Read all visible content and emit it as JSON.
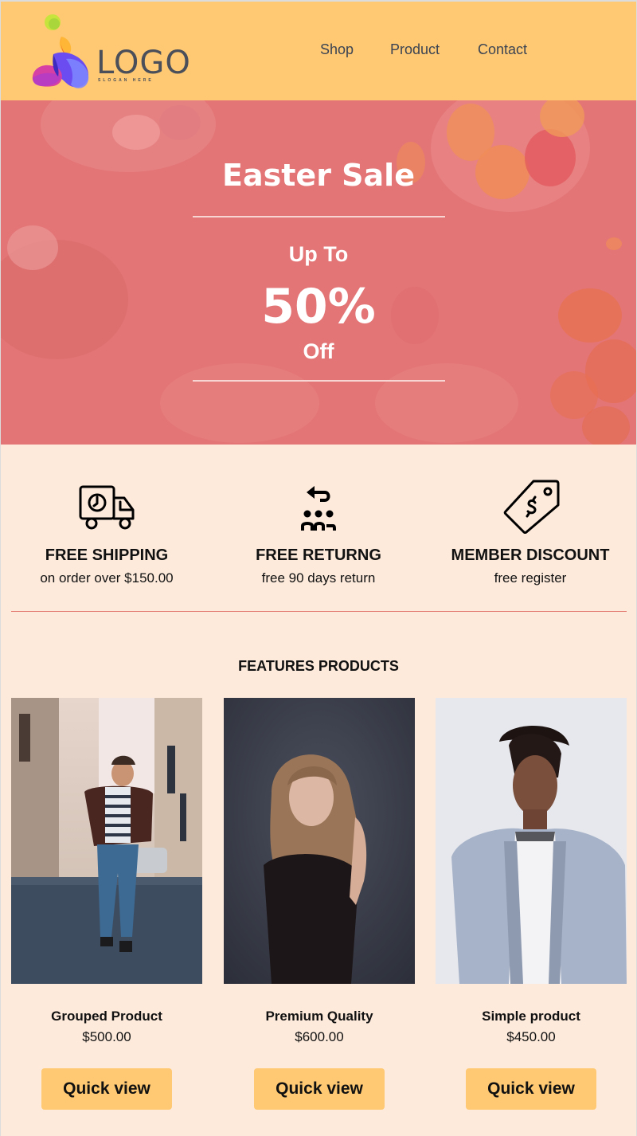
{
  "header": {
    "logo_text": "LOGO",
    "logo_slogan": "SLOGAN HERE",
    "nav": [
      {
        "label": "Shop"
      },
      {
        "label": "Product"
      },
      {
        "label": "Contact"
      }
    ]
  },
  "hero": {
    "title": "Easter Sale",
    "up_to": "Up To",
    "percent": "50%",
    "off": "Off"
  },
  "features": [
    {
      "icon": "delivery-truck-clock-icon",
      "title": "FREE SHIPPING",
      "subtitle": "on order over $150.00"
    },
    {
      "icon": "group-return-icon",
      "title": "FREE RETURNG",
      "subtitle": "free 90 days return"
    },
    {
      "icon": "price-tag-dollar-icon",
      "title": "MEMBER DISCOUNT",
      "subtitle": "free register"
    }
  ],
  "products_section": {
    "title": "FEATURES PRODUCTS",
    "items": [
      {
        "name": "Grouped Product",
        "price": "$500.00",
        "button": "Quick view"
      },
      {
        "name": "Premium Quality",
        "price": "$600.00",
        "button": "Quick view"
      },
      {
        "name": "Simple product",
        "price": "$450.00",
        "button": "Quick view"
      }
    ]
  },
  "colors": {
    "header_bg": "#fec972",
    "hero_overlay": "#e37576",
    "page_bg": "#fdeadb",
    "divider": "#e37b72",
    "button_bg": "#fec972"
  }
}
